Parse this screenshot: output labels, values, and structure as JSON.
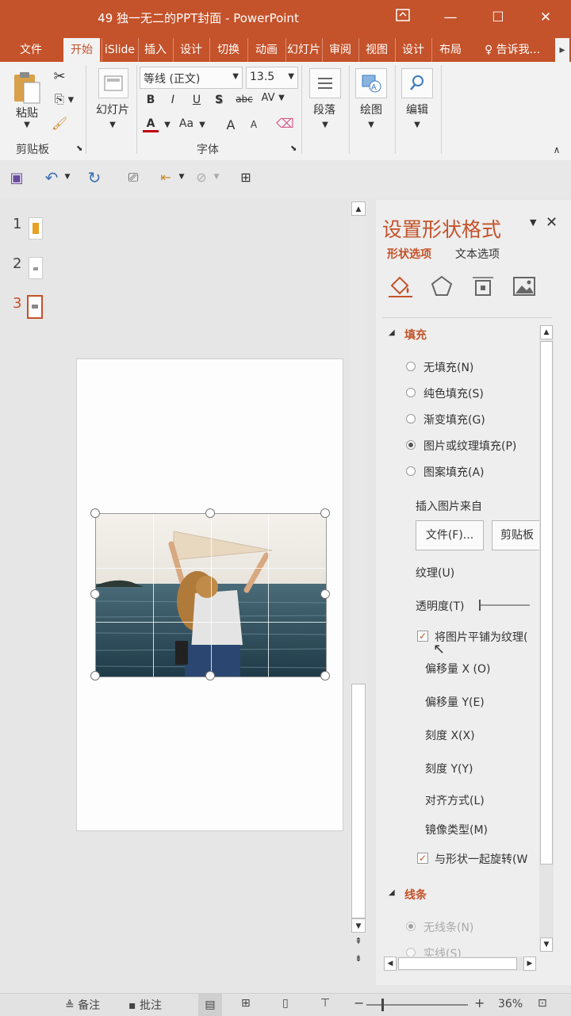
{
  "window": {
    "title": "49 独一无二的PPT封面 - PowerPoint"
  },
  "tabs": [
    "文件",
    "开始",
    "iSlide",
    "插入",
    "设计",
    "切换",
    "动画",
    "幻灯片",
    "审阅",
    "视图",
    "设计",
    "布局"
  ],
  "tell_me": "告诉我...",
  "ribbon": {
    "paste": "粘贴",
    "clipboard_group": "剪贴板",
    "slides": "幻灯片",
    "font_name": "等线 (正文)",
    "font_size": "13.5",
    "bold": "B",
    "italic": "I",
    "underline": "U",
    "shadow": "S",
    "strike": "abc",
    "spacing": "AV",
    "font_color": "A",
    "change_case": "Aa",
    "grow": "A",
    "shrink": "A",
    "font_group": "字体",
    "paragraph": "段落",
    "drawing": "绘图",
    "editing": "编辑"
  },
  "slides_panel": {
    "numbers": [
      "1",
      "2",
      "3"
    ]
  },
  "pane": {
    "title": "设置形状格式",
    "tab_shape": "形状选项",
    "tab_text": "文本选项",
    "fill_header": "填充",
    "fill_options": [
      "无填充(N)",
      "纯色填充(S)",
      "渐变填充(G)",
      "图片或纹理填充(P)",
      "图案填充(A)"
    ],
    "insert_from": "插入图片来自",
    "file_btn": "文件(F)...",
    "clipboard_btn": "剪贴板",
    "texture": "纹理(U)",
    "transparency": "透明度(T)",
    "tile": "将图片平铺为纹理(",
    "offset_x": "偏移量 X (O)",
    "offset_y": "偏移量 Y(E)",
    "scale_x": "刻度 X(X)",
    "scale_y": "刻度 Y(Y)",
    "alignment": "对齐方式(L)",
    "mirror": "镜像类型(M)",
    "rotate_with": "与形状一起旋转(W",
    "line_header": "线条",
    "line_options": [
      "无线条(N)",
      "实线(S)"
    ]
  },
  "status": {
    "notes": "备注",
    "comments": "批注",
    "zoom": "36%"
  },
  "colors": {
    "accent": "#c4522a"
  }
}
